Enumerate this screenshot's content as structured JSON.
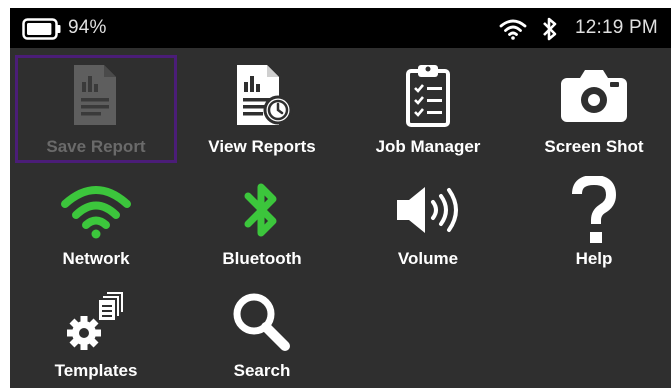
{
  "status": {
    "battery_percent": "94%",
    "battery_level": 0.94,
    "wifi_icon": "wifi-icon",
    "bluetooth_icon": "bluetooth-icon",
    "time": "12:19 PM"
  },
  "colors": {
    "accent_green": "#3cc63c",
    "selection_border": "#4b1d78",
    "background": "#2f2f2f",
    "status_bar": "#000000",
    "disabled": "#6a6a6a"
  },
  "menu": {
    "save_report": {
      "label": "Save Report",
      "icon": "save-report-icon",
      "state": "disabled, selected"
    },
    "view_reports": {
      "label": "View Reports",
      "icon": "view-reports-icon"
    },
    "job_manager": {
      "label": "Job Manager",
      "icon": "clipboard-icon"
    },
    "screen_shot": {
      "label": "Screen Shot",
      "icon": "camera-icon"
    },
    "network": {
      "label": "Network",
      "icon": "wifi-icon"
    },
    "bluetooth": {
      "label": "Bluetooth",
      "icon": "bluetooth-icon"
    },
    "volume": {
      "label": "Volume",
      "icon": "speaker-icon"
    },
    "help": {
      "label": "Help",
      "icon": "question-mark-icon"
    },
    "templates": {
      "label": "Templates",
      "icon": "templates-gear-icon"
    },
    "search": {
      "label": "Search",
      "icon": "magnifier-icon"
    }
  }
}
